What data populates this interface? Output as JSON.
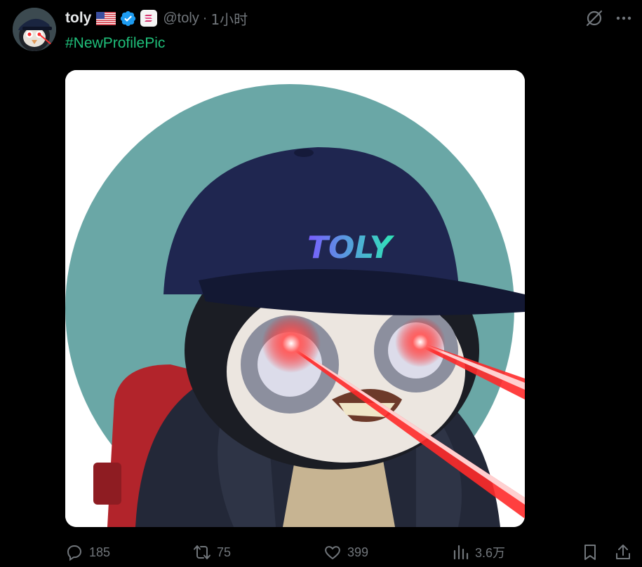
{
  "author": {
    "name": "toly",
    "handle": "@toly",
    "separator": "·",
    "time": "1小时",
    "avatar_icon": "penguin-avatar",
    "flag_icon": "us-flag-icon",
    "verified_icon": "verified-badge-icon",
    "affiliation_icon": "solana-affiliate-icon"
  },
  "post": {
    "hashtag": "#NewProfilePic",
    "hashtag_color": "#1fbf7a",
    "image": {
      "subject_icon": "penguin-laser-eyes-image",
      "cap_text": "TOLY"
    }
  },
  "header_actions": {
    "grok_icon": "grok-icon",
    "more_icon": "more-options-icon"
  },
  "actions": {
    "reply": {
      "icon": "reply-icon",
      "count": "185"
    },
    "retweet": {
      "icon": "retweet-icon",
      "count": "75"
    },
    "like": {
      "icon": "like-icon",
      "count": "399"
    },
    "views": {
      "icon": "views-icon",
      "count": "3.6万"
    },
    "bookmark": {
      "icon": "bookmark-icon"
    },
    "share": {
      "icon": "share-icon"
    }
  },
  "colors": {
    "background": "#000000",
    "text_primary": "#e7e9ea",
    "text_secondary": "#71767b",
    "verified_blue": "#1d9bf0"
  }
}
